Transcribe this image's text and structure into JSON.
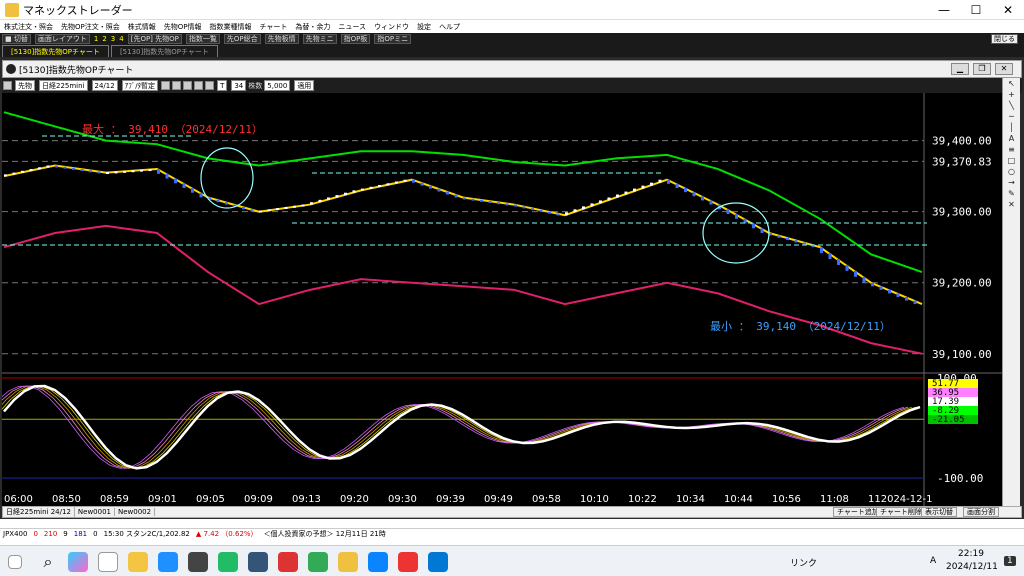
{
  "app": {
    "title": "マネックストレーダー",
    "minimize": "—",
    "maximize": "☐",
    "close": "✕"
  },
  "menu": [
    "株式注文・照会",
    "先物OP注文・照会",
    "株式情報",
    "先物OP情報",
    "指数業種情報",
    "チャート",
    "為替・余力",
    "ニュース",
    "ウィンドウ",
    "設定",
    "ヘルプ"
  ],
  "toolbar": {
    "switch_label": "■ 切替",
    "layout_label": "画面レイアウト",
    "nums": [
      "1",
      "2",
      "3",
      "4"
    ],
    "buttons": [
      "[先OP] 先物OP",
      "指数一覧",
      "先OP総合",
      "先物板情",
      "先物ミニ",
      "指OP板",
      "指OPミニ"
    ],
    "close_label": "閉じる"
  },
  "window_tabs": [
    {
      "label": "[5130]指数先物OPチャート",
      "active": true
    },
    {
      "label": "[5130]指数先物OPチャート",
      "active": false
    }
  ],
  "inner_window": {
    "title": "[5130]指数先物OPチャート"
  },
  "controls": {
    "type": "先物",
    "product": "日経225mini",
    "contract": "24/12",
    "range_label": "ｱﾌﾞ/ﾀ暫定",
    "period": "T",
    "period_value": "34",
    "qty_label": "株数",
    "qty_value": "5,000",
    "apply_label": "適用"
  },
  "chart": {
    "price_labels": [
      "39,400.00",
      "39,300.00",
      "39,200.00",
      "39,100.00"
    ],
    "current_price": "39,370.83",
    "max_annotation": "最大 ： 39,410 （2024/12/11）",
    "min_annotation": "最小 ： 39,140 （2024/12/11）",
    "osc_labels": [
      "100.00",
      "-100.00"
    ],
    "osc_values": [
      "51.77",
      "36.95",
      "17.39",
      "-8.29",
      "-21.05"
    ],
    "osc_value_colors": [
      "#ffff00",
      "#ff80ff",
      "#ffffff",
      "#00ff00",
      "#00c000"
    ],
    "time_labels": [
      "06:00",
      "08:50",
      "08:59",
      "09:01",
      "09:05",
      "09:09",
      "09:13",
      "09:20",
      "09:30",
      "09:39",
      "09:49",
      "09:58",
      "10:10",
      "10:22",
      "10:34",
      "10:44",
      "10:56",
      "11:08",
      "112024-12-1"
    ],
    "upcolor": "#ffffff",
    "downcolor": "#3b6cff"
  },
  "chart_data": {
    "type": "line",
    "title": "",
    "x": [
      "06:00",
      "08:50",
      "08:59",
      "09:01",
      "09:05",
      "09:09",
      "09:13",
      "09:20",
      "09:30",
      "09:39",
      "09:49",
      "09:58",
      "10:10",
      "10:22",
      "10:34",
      "10:44",
      "10:56",
      "11:08",
      "11:15"
    ],
    "ylim": [
      39080,
      39460
    ],
    "series": [
      {
        "values": [
          39350,
          39365,
          39355,
          39360,
          39320,
          39300,
          39310,
          39330,
          39345,
          39320,
          39310,
          39295,
          39320,
          39345,
          39310,
          39270,
          39250,
          39200,
          39170
        ]
      },
      {
        "values": [
          39440,
          39420,
          39400,
          39395,
          39375,
          39365,
          39375,
          39385,
          39385,
          39380,
          39370,
          39365,
          39375,
          39380,
          39360,
          39330,
          39290,
          39240,
          39215
        ]
      },
      {
        "values": [
          39250,
          39270,
          39280,
          39270,
          39215,
          39170,
          39190,
          39205,
          39200,
          39195,
          39190,
          39170,
          39185,
          39200,
          39185,
          39160,
          39140,
          39115,
          39100
        ]
      }
    ],
    "max": {
      "value": 39410,
      "date": "2024/12/11"
    },
    "min": {
      "value": 39140,
      "date": "2024/12/11"
    }
  },
  "statusbar": {
    "contract": "日経225mini 24/12",
    "tabs": [
      "New0001",
      "New0002"
    ],
    "right_buttons": [
      "チャート追加",
      "チャート削除",
      "表示切替",
      "画面分割"
    ]
  },
  "ticker": {
    "label": "JPX400",
    "vals": [
      "0",
      "210",
      "9",
      "181",
      "0"
    ],
    "futures": "15:30 スタン2C/1,202.82",
    "change": "▲ 7.42 （0.62%）",
    "news": "＜個人投資家の予想＞ 12月11日 21時"
  },
  "taskbar": {
    "link": "リンク",
    "ime": "A",
    "time": "22:19",
    "date": "2024/12/11",
    "notif": "1"
  }
}
